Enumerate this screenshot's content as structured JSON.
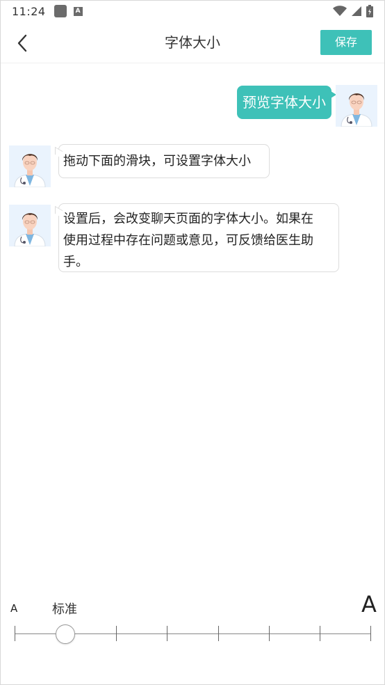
{
  "status_bar": {
    "time": "11:24",
    "notification_badge": "A"
  },
  "header": {
    "title": "字体大小",
    "save_label": "保存"
  },
  "messages": {
    "outgoing": "预览字体大小",
    "incoming_1": "拖动下面的滑块，可设置字体大小",
    "incoming_2_line1": "设置后，会改变聊天页面的字体大小。如果在",
    "incoming_2_line2": "使用过程中存在问题或意见，可反馈给医生助",
    "incoming_2_line3": "手。"
  },
  "font_slider": {
    "small_label": "A",
    "large_label": "A",
    "current_label": "标准",
    "steps": 8,
    "selected_step": 2
  },
  "colors": {
    "accent": "#3ec1b8",
    "avatar_bg": "#eaf3fd"
  },
  "icons": {
    "back": "chevron-left-icon",
    "wifi": "wifi-icon",
    "signal": "signal-icon",
    "battery": "battery-icon"
  }
}
